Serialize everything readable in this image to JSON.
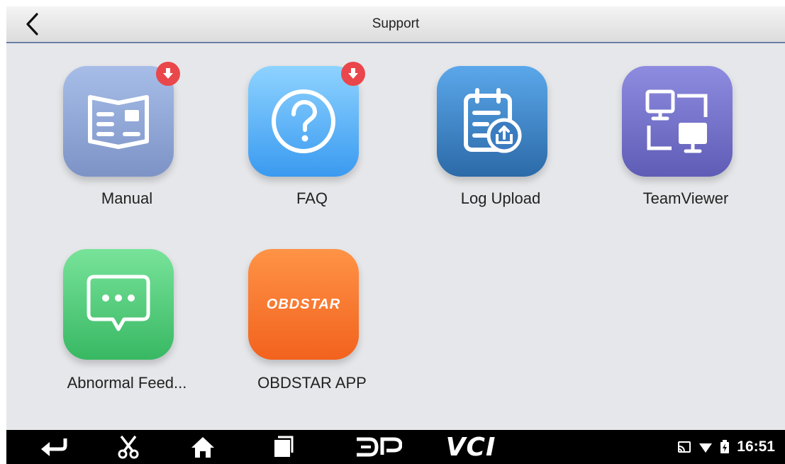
{
  "header": {
    "title": "Support"
  },
  "apps": [
    {
      "label": "Manual",
      "icon": "manual-icon",
      "badge": true,
      "color": "#8ea6d8"
    },
    {
      "label": "FAQ",
      "icon": "question-icon",
      "badge": true,
      "color": "#5ab2f5"
    },
    {
      "label": "Log Upload",
      "icon": "log-upload-icon",
      "badge": false,
      "color": "#3d7fc0"
    },
    {
      "label": "TeamViewer",
      "icon": "teamviewer-icon",
      "badge": false,
      "color": "#7a78cf"
    },
    {
      "label": "Abnormal Feed...",
      "icon": "feedback-icon",
      "badge": false,
      "color": "#4fcf7c"
    },
    {
      "label": "OBDSTAR APP",
      "icon": "obdstar-logo-icon",
      "badge": false,
      "color": "#f67a32",
      "logo_text": "OBDSTAR"
    }
  ],
  "navbar": {
    "vci_label": "VCI",
    "time": "16:51"
  }
}
